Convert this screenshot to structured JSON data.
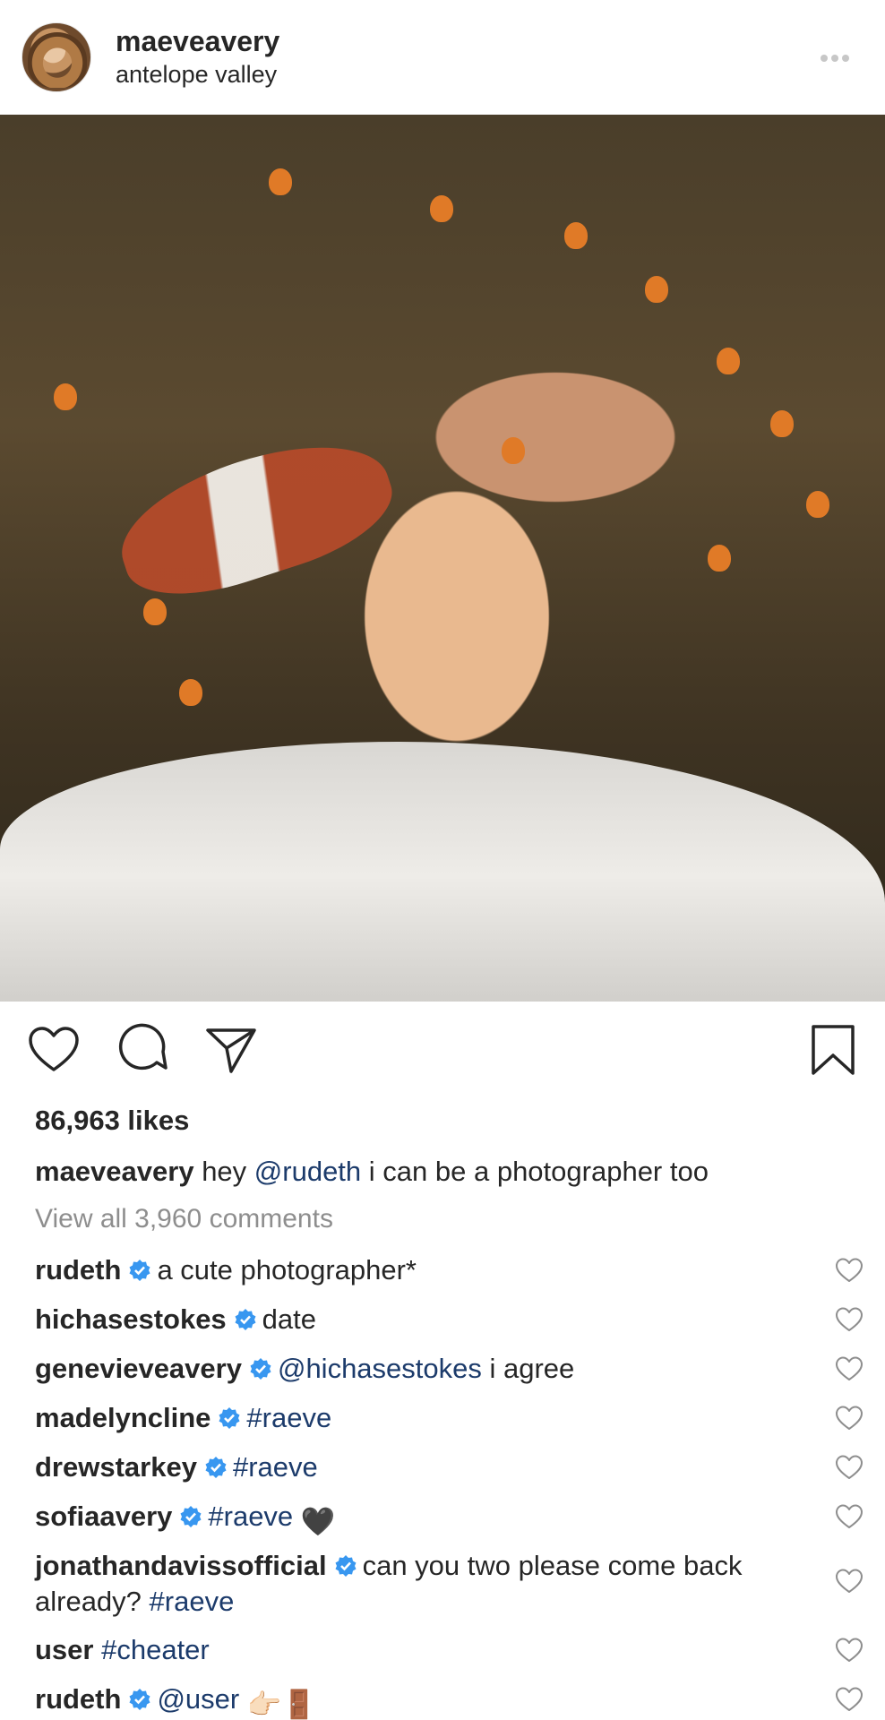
{
  "post": {
    "username": "maeveavery",
    "location": "antelope valley"
  },
  "actions": {
    "like_icon": "heart-icon",
    "comment_icon": "comment-icon",
    "share_icon": "share-icon",
    "save_icon": "bookmark-icon"
  },
  "likes_text": "86,963 likes",
  "caption": {
    "username": "maeveavery",
    "text_before": "hey ",
    "mention": "@rudeth",
    "text_after": " i can be a photographer too"
  },
  "view_all_comments": "View all 3,960 comments",
  "comments": [
    {
      "username": "rudeth",
      "verified": true,
      "parts": [
        {
          "t": "text",
          "v": "a cute photographer*"
        }
      ]
    },
    {
      "username": "hichasestokes",
      "verified": true,
      "parts": [
        {
          "t": "text",
          "v": "date"
        }
      ]
    },
    {
      "username": "genevieveavery",
      "verified": true,
      "parts": [
        {
          "t": "link",
          "v": "@hichasestokes"
        },
        {
          "t": "text",
          "v": " i agree"
        }
      ]
    },
    {
      "username": "madelyncline",
      "verified": true,
      "parts": [
        {
          "t": "link",
          "v": "#raeve"
        }
      ]
    },
    {
      "username": "drewstarkey",
      "verified": true,
      "parts": [
        {
          "t": "link",
          "v": "#raeve"
        }
      ]
    },
    {
      "username": "sofiaavery",
      "verified": true,
      "parts": [
        {
          "t": "link",
          "v": "#raeve"
        },
        {
          "t": "text",
          "v": " "
        },
        {
          "t": "emoji",
          "v": "🖤"
        }
      ]
    },
    {
      "username": "jonathandavissofficial",
      "verified": true,
      "parts": [
        {
          "t": "text",
          "v": "can you two please come back already? "
        },
        {
          "t": "link",
          "v": "#raeve"
        }
      ]
    },
    {
      "username": "user",
      "verified": false,
      "parts": [
        {
          "t": "link",
          "v": "#cheater"
        }
      ]
    },
    {
      "username": "rudeth",
      "verified": true,
      "parts": [
        {
          "t": "link",
          "v": "@user"
        },
        {
          "t": "text",
          "v": " "
        },
        {
          "t": "emoji",
          "v": "👉🏻"
        },
        {
          "t": "emoji",
          "v": "🚪"
        }
      ]
    }
  ],
  "colors": {
    "text": "#262626",
    "muted": "#8e8e8e",
    "link": "#1c3b6b",
    "verified": "#3897f0"
  }
}
